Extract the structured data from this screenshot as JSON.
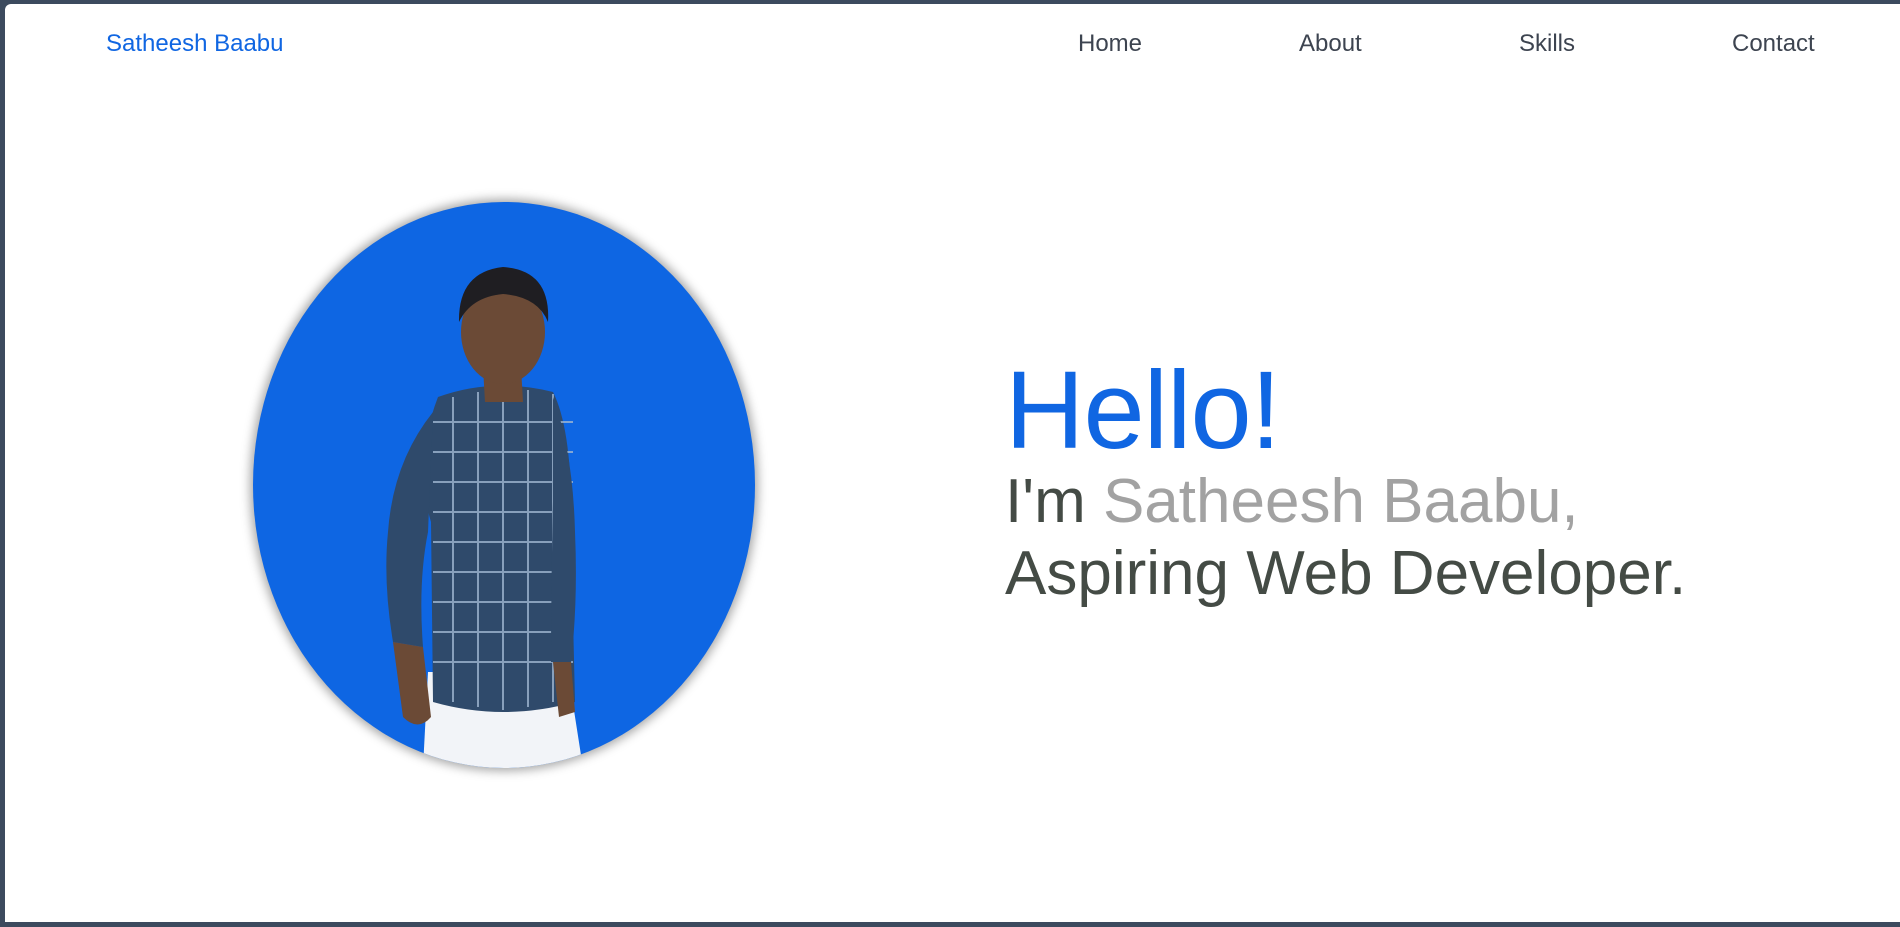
{
  "nav": {
    "brand": "Satheesh Baabu",
    "links": [
      {
        "label": "Home"
      },
      {
        "label": "About"
      },
      {
        "label": "Skills"
      },
      {
        "label": "Contact"
      }
    ]
  },
  "hero": {
    "greeting": "Hello!",
    "intro_prefix": "I'm ",
    "name": "Satheesh Baabu,",
    "role": "Aspiring Web Developer."
  },
  "colors": {
    "accent": "#1066e2",
    "text": "#444b45",
    "muted": "#a2a2a2"
  },
  "icons": {
    "profile_photo": "profile-photo"
  }
}
